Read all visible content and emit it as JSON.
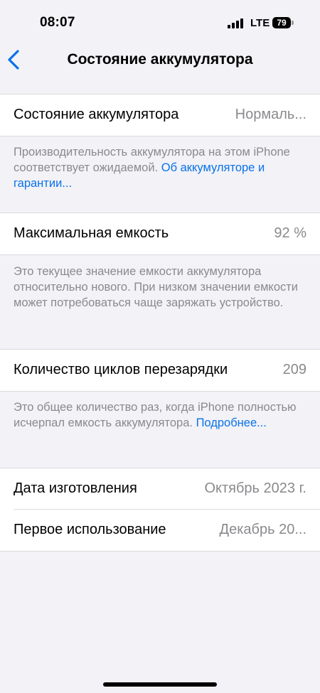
{
  "status_bar": {
    "time": "08:07",
    "network": "LTE",
    "battery_level": "79"
  },
  "nav": {
    "title": "Состояние аккумулятора",
    "back_icon": "chevron-left-icon"
  },
  "battery_health": {
    "label": "Состояние аккумулятора",
    "value": "Нормаль...",
    "footer_text": "Производительность аккумулятора на этом iPhone соответствует ожидаемой. ",
    "footer_link": "Об аккумуляторе и гарантии..."
  },
  "max_capacity": {
    "label": "Максимальная емкость",
    "value": "92 %",
    "footer_text": "Это текущее значение емкости аккумулятора относительно нового. При низком значении емкости может потребоваться чаще заряжать устройство."
  },
  "cycle_count": {
    "label": "Количество циклов перезарядки",
    "value": "209",
    "footer_text": "Это общее количество раз, когда iPhone полностью исчерпал емкость аккумулятора. ",
    "footer_link": "Подробнее..."
  },
  "dates": {
    "manufacture_label": "Дата изготовления",
    "manufacture_value": "Октябрь 2023 г.",
    "first_use_label": "Первое использование",
    "first_use_value": "Декабрь 20..."
  },
  "colors": {
    "accent": "#0a72e8",
    "background": "#f2f2f7",
    "secondary_text": "#8a8a8e"
  }
}
